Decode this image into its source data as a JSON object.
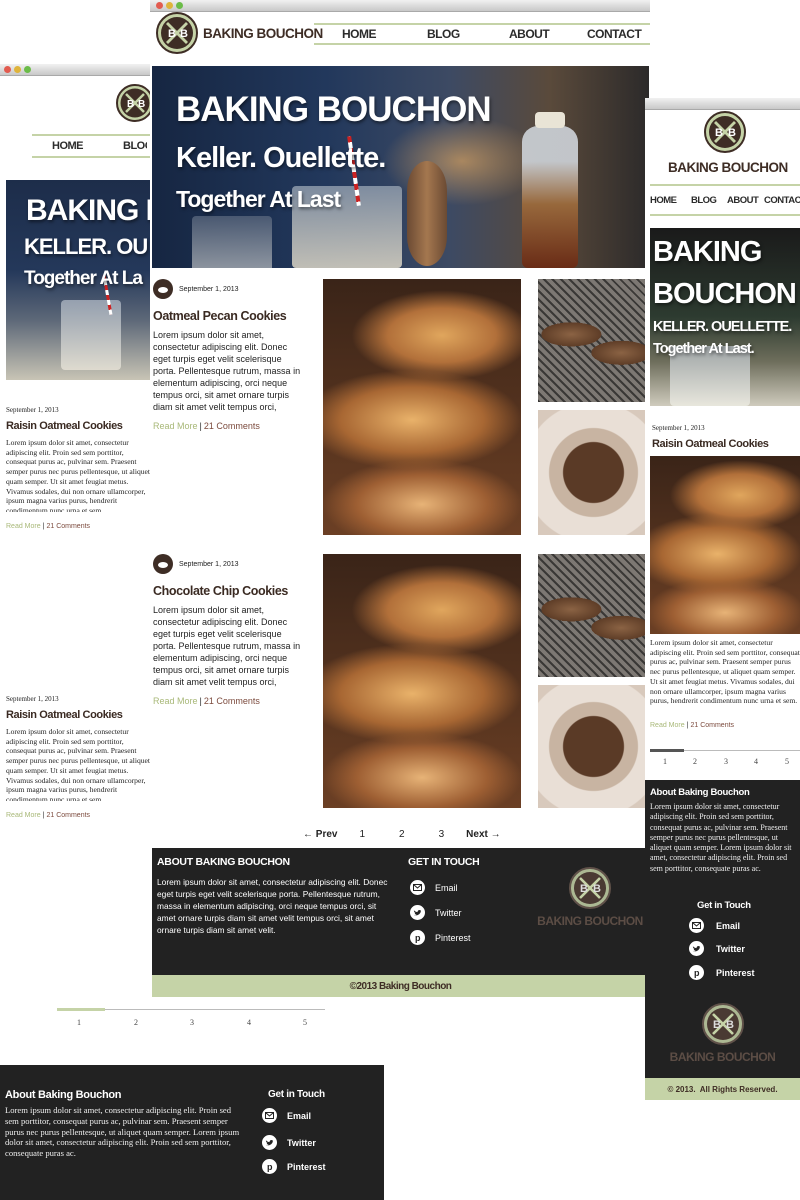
{
  "brand": {
    "name": "BAKING BOUCHON",
    "initial_left": "B",
    "initial_right": "B"
  },
  "nav": {
    "home": "HOME",
    "blog": "BLOG",
    "about": "ABOUT",
    "contact": "CONTACT"
  },
  "hero": {
    "line1": "BAKING BOUCHON",
    "line2": "Keller. Ouellette.",
    "line2_caps": "KELLER. OUELLETTE.",
    "line3": "Together At Last",
    "line3_period": "Together At Last.",
    "left_line1": "BAKING B",
    "left_line2": "KELLER. OU",
    "left_line3": "Together At La",
    "right_line1a": "BAKING",
    "right_line1b": "BOUCHON"
  },
  "posts": {
    "post1": {
      "date": "September 1, 2013",
      "title": "Oatmeal Pecan Cookies",
      "excerpt": "Lorem ipsum dolor sit amet, consectetur adipiscing elit. Donec eget turpis eget velit scelerisque porta. Pellentesque rutrum, massa in elementum adipiscing, orci neque tempus orci, sit amet ornare turpis diam sit amet velit tempus orci,",
      "read_more": "Read More",
      "sep": "|",
      "comments": "21 Comments"
    },
    "post2": {
      "date": "September 1, 2013",
      "title": "Chocolate Chip Cookies",
      "excerpt": "Lorem ipsum dolor sit amet, consectetur adipiscing elit. Donec eget turpis eget velit scelerisque porta. Pellentesque rutrum, massa in elementum adipiscing, orci neque tempus orci, sit amet ornare turpis diam sit amet velit tempus orci,",
      "read_more": "Read More",
      "sep": "|",
      "comments": "21 Comments"
    },
    "left1": {
      "date": "September 1, 2013",
      "title": "Raisin Oatmeal Cookies",
      "excerpt": "Lorem ipsum dolor sit amet, consectetur adipiscing elit. Proin sed sem porttitor, consequat purus ac, pulvinar sem. Praesent semper purus nec purus pellentesque, ut aliquet quam semper. Ut sit amet feugiat metus. Vivamus sodales, dui non ornare ullamcorper, ipsum magna varius purus, hendrerit condimentum nunc urna et sem.",
      "read_more": "Read More",
      "sep": "|",
      "comments": "21 Comments"
    },
    "left2": {
      "date": "September 1, 2013",
      "title": "Raisin Oatmeal Cookies",
      "excerpt": "Lorem ipsum dolor sit amet, consectetur adipiscing elit. Proin sed sem porttitor, consequat purus ac, pulvinar sem. Praesent semper purus nec purus pellentesque, ut aliquet quam semper. Ut sit amet feugiat metus. Vivamus sodales, dui non ornare ullamcorper, ipsum magna varius purus, hendrerit condimentum nunc urna et sem.",
      "read_more": "Read More",
      "sep": "|",
      "comments": "21 Comments"
    },
    "right1": {
      "date": "September 1, 2013",
      "title": "Raisin Oatmeal Cookies",
      "excerpt": "Lorem ipsum dolor sit amet, consectetur adipiscing elit. Proin sed sem porttitor, consequat purus ac, pulvinar sem. Praesent semper purus nec purus pellentesque, ut aliquet quam semper. Ut sit amet feugiat metus. Vivamus sodales, dui non ornare ullamcorper, ipsum magna varius purus, hendrerit condimentum nunc urna et sem.",
      "read_more": "Read More",
      "sep": "|",
      "comments": "21 Comments"
    }
  },
  "pager": {
    "prev": "← Prev",
    "p1": "1",
    "p2": "2",
    "p3": "3",
    "next": "Next →",
    "p4": "4",
    "p5": "5"
  },
  "footer": {
    "about_title": "ABOUT BAKING BOUCHON",
    "about_title_mixed": "About Baking Bouchon",
    "about_text": "Lorem ipsum dolor sit amet, consectetur adipiscing elit. Donec eget turpis eget velit scelerisque porta. Pellentesque rutrum, massa in elementum adipiscing, orci neque tempus orci, sit amet ornare turpis diam sit amet velit tempus orci, sit amet ornare turpis diam sit amet velit.",
    "about_text_serif": "Lorem ipsum dolor sit amet, consectetur adipiscing elit. Proin sed sem porttitor, consequat purus ac, pulvinar sem. Praesent semper purus nec purus pellentesque, ut aliquet quam semper. Lorem ipsum dolor sit amet, consectetur adipiscing elit. Proin sed sem porttitor, consequate puras ac.",
    "touch_title": "GET IN TOUCH",
    "touch_title_mixed": "Get in Touch",
    "email": "Email",
    "twitter": "Twitter",
    "pinterest": "Pinterest",
    "copyright": "©2013 Baking Bouchon",
    "copyright_right": "© 2013.  All Rights Reserved."
  },
  "colors": {
    "brand_brown": "#3e2d25",
    "accent_green": "#c5d3a7",
    "footer_dark": "#222222"
  }
}
